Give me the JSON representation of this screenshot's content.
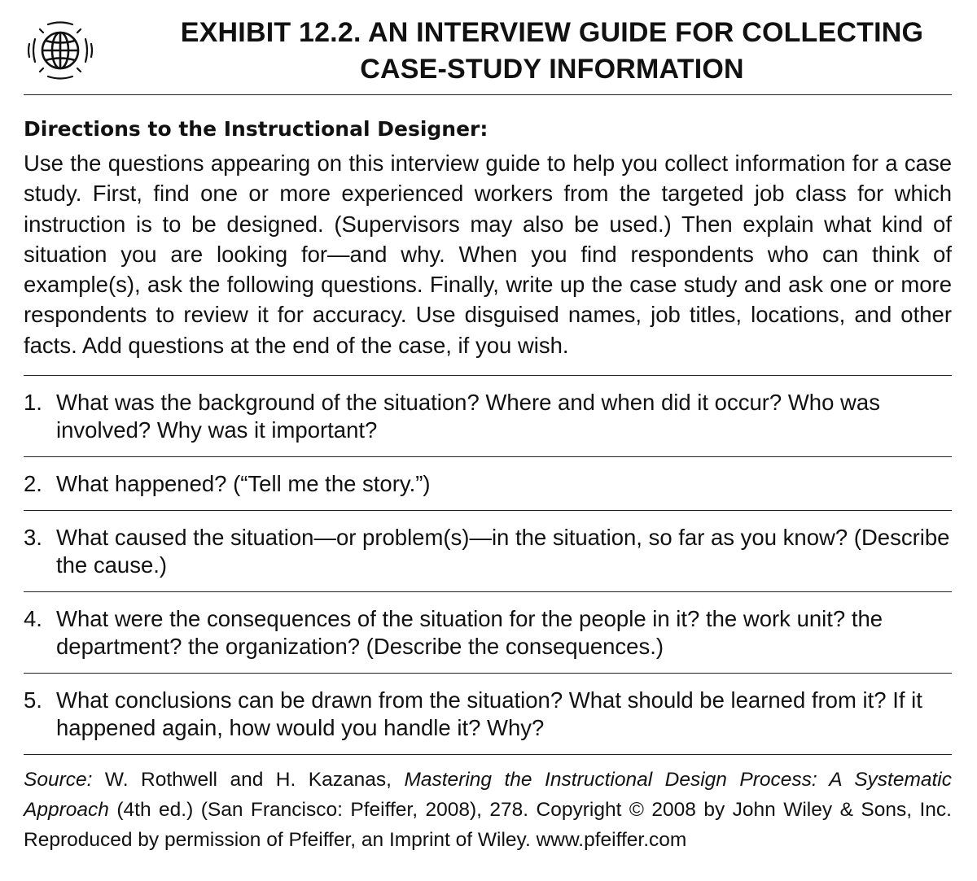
{
  "exhibit": {
    "title_line1": "EXHIBIT 12.2. AN INTERVIEW GUIDE FOR COLLECTING",
    "title_line2": "CASE-STUDY INFORMATION",
    "icon": "globe-icon"
  },
  "directions": {
    "heading": "Directions to the Instructional Designer:",
    "body": "Use the questions appearing on this interview guide to help you collect information for a case study. First, find one or more experienced workers from the targeted job class for which instruction is to be designed. (Supervisors may also be used.) Then explain what kind of situation you are looking for—and why. When you find respondents who can think of example(s), ask the following questions. Finally, write up the case study and ask one or more respondents to review it for accuracy. Use disguised names, job titles, locations, and other facts. Add questions at the end of the case, if you wish."
  },
  "questions": [
    {
      "num": "1.",
      "text": "What was the background of the situation? Where and when did it occur? Who was involved? Why was it important?"
    },
    {
      "num": "2.",
      "text": "What happened? (“Tell me the story.”)"
    },
    {
      "num": "3.",
      "text": "What caused the situation—or problem(s)—in the situation, so far as you know? (Describe the cause.)"
    },
    {
      "num": "4.",
      "text": "What were the consequences of the situation for the people in it? the work unit? the department? the organization? (Describe the consequences.)"
    },
    {
      "num": "5.",
      "text": "What conclusions can be drawn from the situation? What should be learned from it? If it happened again, how would you handle it? Why?"
    }
  ],
  "source": {
    "label": "Source:",
    "authors": " W. Rothwell and H. Kazanas, ",
    "book_title": "Mastering the Instructional Design Process: A Systematic Approach",
    "rest": " (4th ed.) (San Francisco: Pfeiffer, 2008), 278. Copyright © 2008 by John Wiley & Sons, Inc. Reproduced by permission of Pfeiffer, an Imprint of Wiley. www.pfeiffer.com"
  }
}
